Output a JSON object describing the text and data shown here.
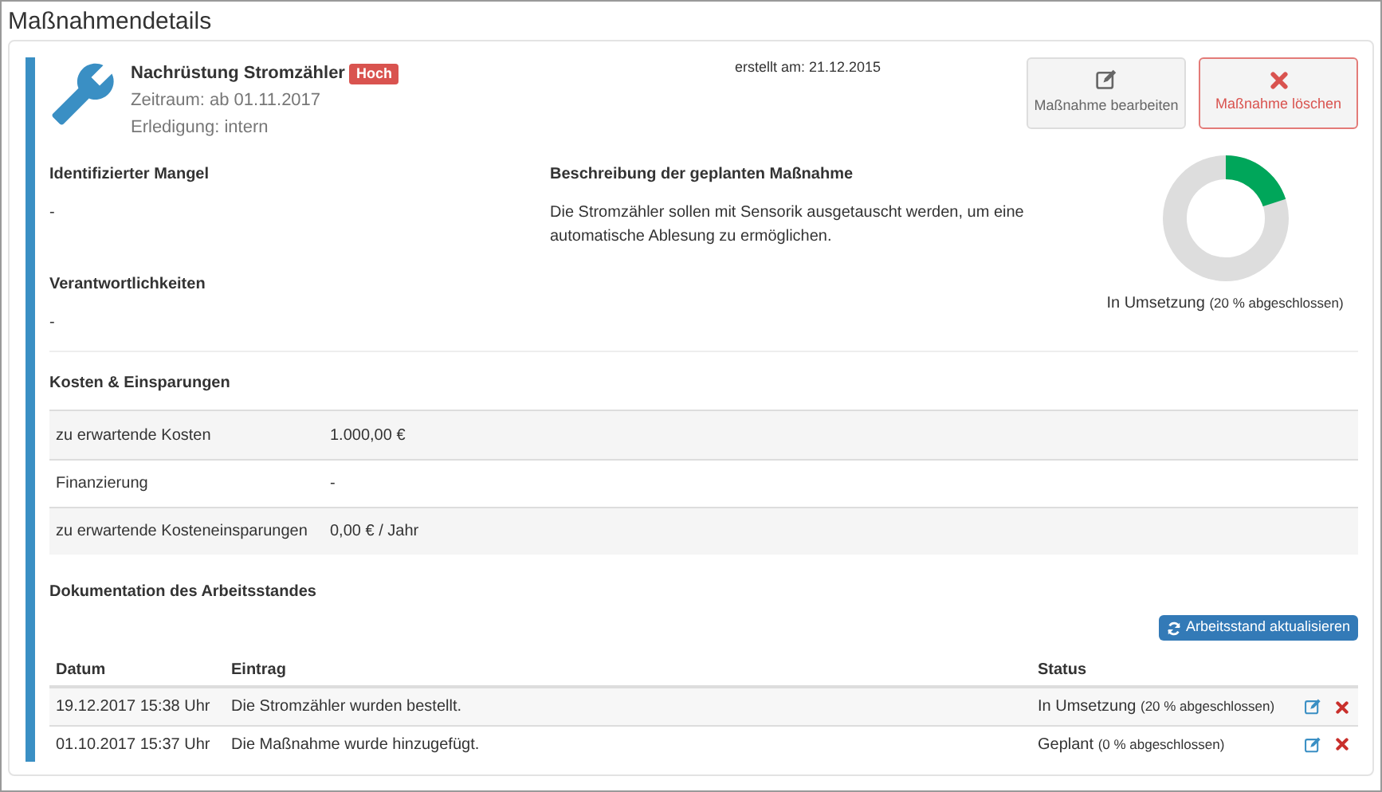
{
  "page_title": "Maßnahmendetails",
  "measure": {
    "title": "Nachrüstung Stromzähler",
    "priority": "Hoch",
    "period": "Zeitraum: ab 01.11.2017",
    "handling": "Erledigung: intern",
    "created": "erstellt am: 21.12.2015"
  },
  "actions": [
    {
      "kind": "edit",
      "label": "Maßnahme bearbeiten"
    },
    {
      "kind": "delete",
      "label": "Maßnahme löschen"
    }
  ],
  "deficiency": {
    "heading": "Identifizierter Mangel",
    "text": "-"
  },
  "description": {
    "heading": "Beschreibung der geplanten Maßnahme",
    "text": "Die Stromzähler sollen mit Sensorik ausgetauscht werden, um eine automatische Ablesung zu ermöglichen."
  },
  "progress": {
    "level": 0.2,
    "status": "In Umsetzung",
    "detail": "(20 % abgeschlossen)"
  },
  "responsibilities": {
    "heading": "Verantwortlichkeiten",
    "text": "-"
  },
  "costs": {
    "heading": "Kosten & Einsparungen",
    "rows": [
      {
        "label": "zu erwartende Kosten",
        "value": "1.000,00 €"
      },
      {
        "label": "Finanzierung",
        "value": "-"
      },
      {
        "label": "zu erwartende Kosteneinsparungen",
        "value": "0,00 € / Jahr"
      }
    ]
  },
  "documentation": {
    "heading": "Dokumentation des Arbeitsstandes",
    "update_button": "Arbeitsstand aktualisieren",
    "columns": [
      "Datum",
      "Eintrag",
      "Status"
    ],
    "rows": [
      {
        "date": "19.12.2017 15:38 Uhr",
        "entry": "Die Stromzähler wurden bestellt.",
        "status": "In Umsetzung",
        "detail": "(20 % abgeschlossen)"
      },
      {
        "date": "01.10.2017 15:37 Uhr",
        "entry": "Die Maßnahme wurde hinzugefügt.",
        "status": "Geplant",
        "detail": "(0 % abgeschlossen)"
      }
    ]
  }
}
